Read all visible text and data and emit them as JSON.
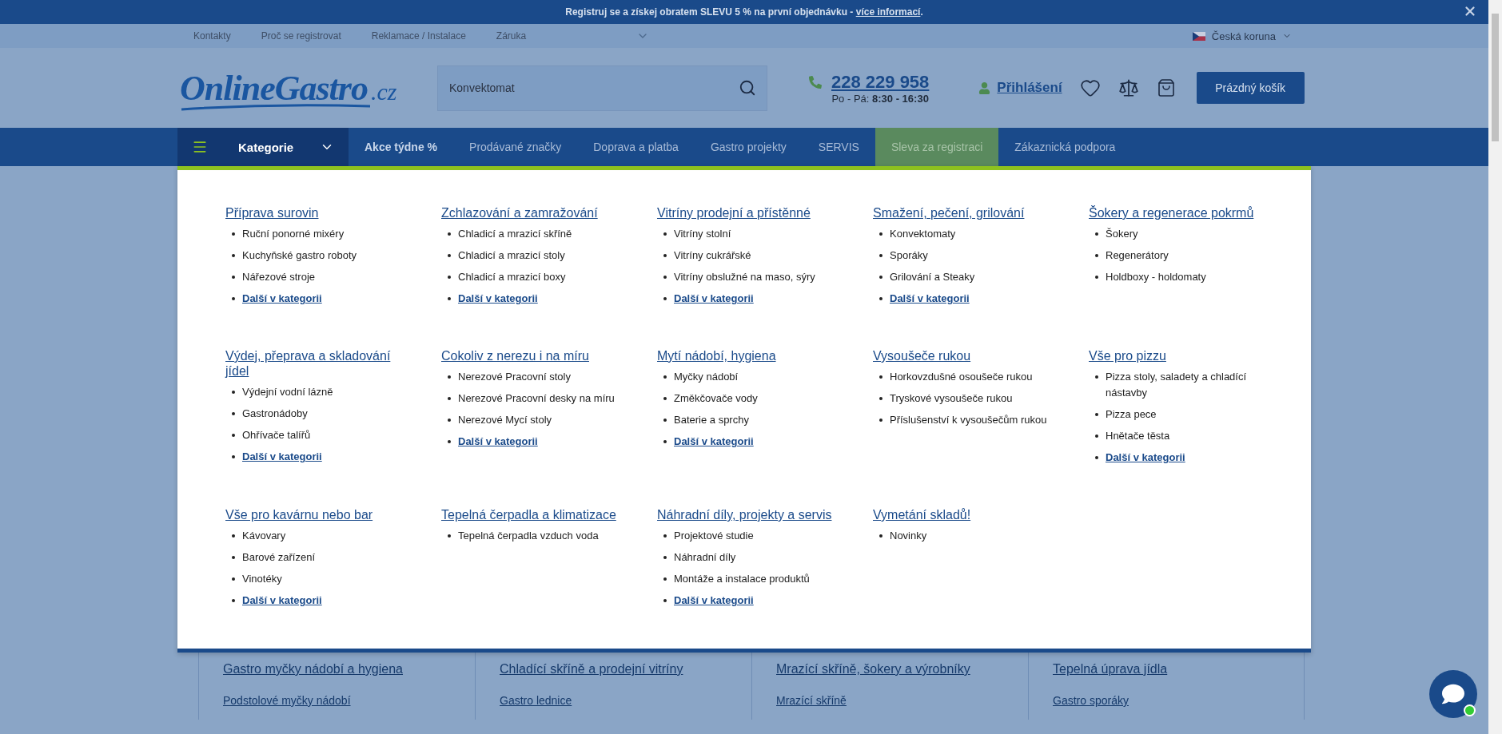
{
  "announcement": {
    "text": "Registruj se a získej obratem SLEVU 5 % na první objednávku - ",
    "link": "více informací",
    "end": "."
  },
  "top_links": [
    "Kontakty",
    "Proč se registrovat",
    "Reklamace / Instalace",
    "Záruka"
  ],
  "currency": "Česká koruna",
  "header": {
    "logo": "OnlineGastro",
    "logo_suffix": ".cz",
    "search_value": "Konvektomat",
    "phone": "228 229 958",
    "hours_label": "Po - Pá:",
    "hours": "8:30 - 16:30",
    "login": "Přihlášení",
    "cart": "Prázdný košík"
  },
  "nav": {
    "categories": {
      "label": "Kategorie",
      "expanded": true
    },
    "items": [
      {
        "label": "Akce týdne %",
        "kind": "bold"
      },
      {
        "label": "Prodávané značky",
        "kind": "normal"
      },
      {
        "label": "Doprava a platba",
        "kind": "normal"
      },
      {
        "label": "Gastro projekty",
        "kind": "normal"
      },
      {
        "label": "SERVIS",
        "kind": "normal"
      },
      {
        "label": "Sleva za registraci",
        "kind": "promo"
      },
      {
        "label": "Zákaznická podpora",
        "kind": "normal"
      }
    ]
  },
  "menu": [
    {
      "title": "Příprava surovin",
      "items": [
        {
          "label": "Ruční ponorné mixéry",
          "kind": "item"
        },
        {
          "label": "Kuchyňské gastro roboty",
          "kind": "item"
        },
        {
          "label": "Nářezové stroje",
          "kind": "item"
        },
        {
          "label": "Další v kategorii",
          "kind": "more"
        }
      ]
    },
    {
      "title": "Zchlazování a zamražování",
      "items": [
        {
          "label": "Chladicí a mrazicí skříně",
          "kind": "item"
        },
        {
          "label": "Chladicí a mrazicí stoly",
          "kind": "item"
        },
        {
          "label": "Chladicí a mrazicí boxy",
          "kind": "item"
        },
        {
          "label": "Další v kategorii",
          "kind": "more"
        }
      ]
    },
    {
      "title": "Vitríny prodejní a přístěnné",
      "items": [
        {
          "label": "Vitríny stolní",
          "kind": "item"
        },
        {
          "label": "Vitríny cukrářské",
          "kind": "item"
        },
        {
          "label": "Vitríny obslužné na maso, sýry",
          "kind": "item"
        },
        {
          "label": "Další v kategorii",
          "kind": "more"
        }
      ]
    },
    {
      "title": "Smažení, pečení, grilování",
      "items": [
        {
          "label": "Konvektomaty",
          "kind": "item"
        },
        {
          "label": "Sporáky",
          "kind": "item"
        },
        {
          "label": "Grilování a Steaky",
          "kind": "item"
        },
        {
          "label": "Další v kategorii",
          "kind": "more"
        }
      ]
    },
    {
      "title": "Šokery a regenerace pokrmů",
      "items": [
        {
          "label": "Šokery",
          "kind": "item"
        },
        {
          "label": "Regenerátory",
          "kind": "item"
        },
        {
          "label": "Holdboxy - holdomaty",
          "kind": "item"
        }
      ]
    },
    {
      "title": "Výdej, přeprava a skladování jídel",
      "items": [
        {
          "label": "Výdejní vodní lázně",
          "kind": "item"
        },
        {
          "label": "Gastronádoby",
          "kind": "item"
        },
        {
          "label": "Ohřívače talířů",
          "kind": "item"
        },
        {
          "label": "Další v kategorii",
          "kind": "more"
        }
      ]
    },
    {
      "title": "Cokoliv z nerezu i na míru",
      "items": [
        {
          "label": "Nerezové Pracovní stoly",
          "kind": "item"
        },
        {
          "label": "Nerezové Pracovní desky na míru",
          "kind": "item"
        },
        {
          "label": "Nerezové Mycí stoly",
          "kind": "item"
        },
        {
          "label": "Další v kategorii",
          "kind": "more"
        }
      ]
    },
    {
      "title": "Mytí nádobí, hygiena",
      "items": [
        {
          "label": "Myčky nádobí",
          "kind": "item"
        },
        {
          "label": "Změkčovače vody",
          "kind": "item"
        },
        {
          "label": "Baterie a sprchy",
          "kind": "item"
        },
        {
          "label": "Další v kategorii",
          "kind": "more"
        }
      ]
    },
    {
      "title": "Vysoušeče rukou",
      "items": [
        {
          "label": "Horkovzdušné osoušeče rukou",
          "kind": "item"
        },
        {
          "label": "Tryskové vysoušeče rukou",
          "kind": "item"
        },
        {
          "label": "Příslušenství k vysoušečům rukou",
          "kind": "item"
        }
      ]
    },
    {
      "title": "Vše pro pizzu",
      "items": [
        {
          "label": "Pizza stoly, saladety a chladící nástavby",
          "kind": "item"
        },
        {
          "label": "Pizza pece",
          "kind": "item"
        },
        {
          "label": "Hnětače těsta",
          "kind": "item"
        },
        {
          "label": "Další v kategorii",
          "kind": "more"
        }
      ]
    },
    {
      "title": "Vše pro kavárnu nebo bar",
      "items": [
        {
          "label": "Kávovary",
          "kind": "item"
        },
        {
          "label": "Barové zařízení",
          "kind": "item"
        },
        {
          "label": "Vinotéky",
          "kind": "item"
        },
        {
          "label": "Další v kategorii",
          "kind": "more"
        }
      ]
    },
    {
      "title": "Tepelná čerpadla a klimatizace",
      "items": [
        {
          "label": "Tepelná čerpadla vzduch voda",
          "kind": "item"
        }
      ]
    },
    {
      "title": "Náhradní díly, projekty a servis",
      "items": [
        {
          "label": "Projektové studie",
          "kind": "item"
        },
        {
          "label": "Náhradní díly",
          "kind": "item"
        },
        {
          "label": "Montáže a instalace produktů",
          "kind": "item"
        },
        {
          "label": "Další v kategorii",
          "kind": "more"
        }
      ]
    },
    {
      "title": "Vymetání skladů!",
      "items": [
        {
          "label": "Novinky",
          "kind": "item"
        }
      ]
    }
  ],
  "below_cards": [
    {
      "title": "Gastro myčky nádobí a hygiena",
      "link": "Podstolové myčky nádobí"
    },
    {
      "title": "Chladící skříně a prodejní vitríny",
      "link": "Gastro lednice"
    },
    {
      "title": "Mrazící skříně, šokery a výrobníky",
      "link": "Mrazící skříně"
    },
    {
      "title": "Tepelná úprava jídla",
      "link": "Gastro sporáky"
    }
  ],
  "chat": {
    "online": true
  }
}
